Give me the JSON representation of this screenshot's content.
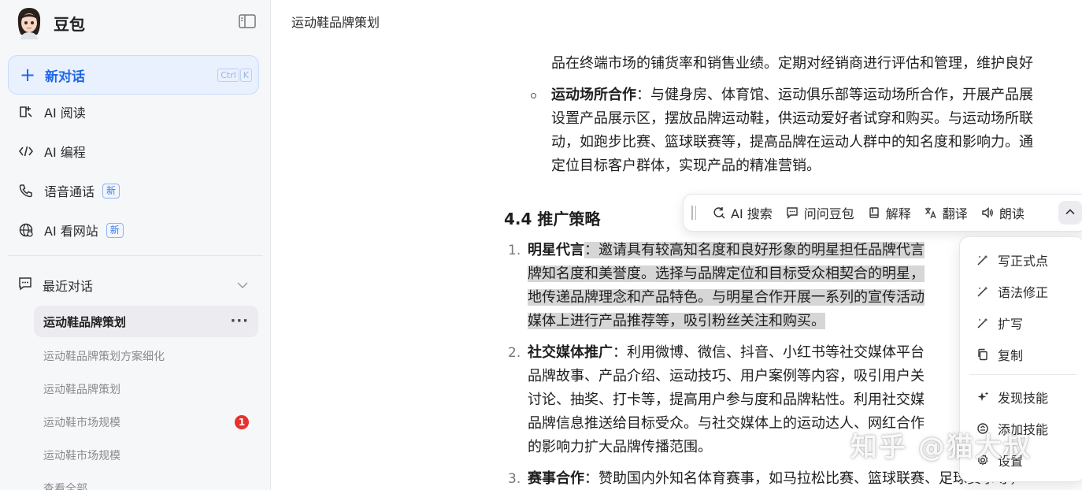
{
  "app": {
    "name": "豆包"
  },
  "sidebar": {
    "new_chat": {
      "label": "新对话",
      "shortcut": [
        "Ctrl",
        "K"
      ]
    },
    "items": [
      {
        "label": "AI 阅读",
        "icon": "reading-icon"
      },
      {
        "label": "AI 编程",
        "icon": "code-icon"
      },
      {
        "label": "语音通话",
        "icon": "phone-icon",
        "badge": "新"
      },
      {
        "label": "AI 看网站",
        "icon": "globe-icon",
        "badge": "新"
      }
    ],
    "recent": {
      "label": "最近对话",
      "conversations": [
        {
          "title": "运动鞋品牌策划",
          "active": true
        },
        {
          "title": "运动鞋品牌策划方案细化"
        },
        {
          "title": "运动鞋品牌策划"
        },
        {
          "title": "运动鞋市场规模",
          "badge": "1"
        },
        {
          "title": "运动鞋市场规模"
        },
        {
          "title": "查看全部"
        }
      ]
    }
  },
  "main": {
    "title": "运动鞋品牌策划",
    "top_line": "品在终端市场的铺货率和销售业绩。定期对经销商进行评估和管理，维护良好",
    "venue": {
      "term": "运动场所合作",
      "lines": [
        "：与健身房、体育馆、运动俱乐部等运动场所合作，开展产品展",
        "设置产品展示区，摆放品牌运动鞋，供运动爱好者试穿和购买。与运动场所联",
        "动，如跑步比赛、篮球联赛等，提高品牌在运动人群中的知名度和影响力。通",
        "定位目标客户群体，实现产品的精准营销。"
      ]
    },
    "section": "4.4 推广策略",
    "items": [
      {
        "num": "1.",
        "term": "明星代言",
        "lines": [
          "：邀请具有较高知名度和良好形象的明星担任品牌代言",
          "牌知名度和美誉度。选择与品牌定位和目标受众相契合的明星，",
          "地传递品牌理念和产品特色。与明星合作开展一系列的宣传活动",
          "媒体上进行产品推荐等，吸引粉丝关注和购买。"
        ]
      },
      {
        "num": "2.",
        "term": "社交媒体推广",
        "lines": [
          "：利用微博、微信、抖音、小红书等社交媒体平台",
          "品牌故事、产品介绍、运动技巧、用户案例等内容，吸引用户关",
          "讨论、抽奖、打卡等，提高用户参与度和品牌粘性。利用社交媒",
          "品牌信息推送给目标受众。与社交媒体上的运动达人、网红合作",
          "的影响力扩大品牌传播范围。"
        ]
      },
      {
        "num": "3.",
        "term": "赛事合作",
        "lines": [
          "：赞助国内外知名体育赛事，如马拉松比赛、篮球联赛、足球赛事等，"
        ]
      }
    ]
  },
  "toolbar": {
    "buttons": [
      {
        "label": "AI 搜索",
        "icon": "ai-search-icon"
      },
      {
        "label": "问问豆包",
        "icon": "chat-bubble-icon"
      },
      {
        "label": "解释",
        "icon": "bookmark-icon"
      },
      {
        "label": "翻译",
        "icon": "translate-icon"
      },
      {
        "label": "朗读",
        "icon": "speaker-icon"
      }
    ]
  },
  "menu": {
    "items": [
      {
        "label": "写正式点",
        "icon": "magic-pen-icon"
      },
      {
        "label": "语法修正",
        "icon": "magic-pen-icon"
      },
      {
        "label": "扩写",
        "icon": "magic-pen-icon"
      },
      {
        "label": "复制",
        "icon": "copy-icon"
      },
      {
        "label": "发现技能",
        "icon": "sparkle-icon"
      },
      {
        "label": "添加技能",
        "icon": "add-skill-icon"
      },
      {
        "label": "设置",
        "icon": "gear-icon"
      }
    ]
  },
  "watermark": "知乎 @猫大叔",
  "colors": {
    "accent": "#1f66e6",
    "highlight": "#d6d6d6",
    "badge_red": "#e5322d"
  }
}
